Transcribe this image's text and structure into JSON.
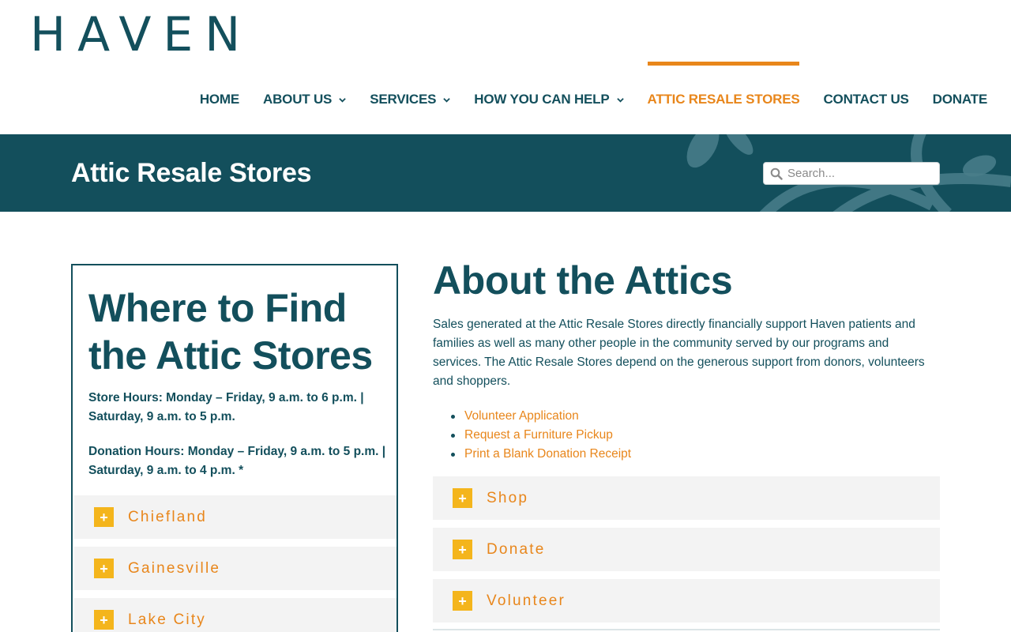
{
  "brand": {
    "logo": "HAVEN"
  },
  "nav": {
    "items": [
      {
        "label": "HOME",
        "has_dropdown": false
      },
      {
        "label": "ABOUT US",
        "has_dropdown": true
      },
      {
        "label": "SERVICES",
        "has_dropdown": true
      },
      {
        "label": "HOW YOU CAN HELP",
        "has_dropdown": true
      },
      {
        "label": "ATTIC RESALE STORES",
        "has_dropdown": false,
        "active": true
      },
      {
        "label": "CONTACT US",
        "has_dropdown": false
      },
      {
        "label": "DONATE",
        "has_dropdown": false
      }
    ]
  },
  "banner": {
    "title": "Attic Resale Stores",
    "search_placeholder": "Search..."
  },
  "sidebar": {
    "title": "Where to Find the Attic Stores",
    "store_hours": "Store Hours: Monday – Friday, 9 a.m. to 6 p.m. | Saturday, 9 a.m. to 5 p.m.",
    "donation_hours": "Donation Hours: Monday – Friday, 9 a.m. to 5 p.m. | Saturday, 9 a.m. to 4 p.m. *",
    "locations": [
      {
        "label": "Chiefland",
        "icon": "+"
      },
      {
        "label": "Gainesville",
        "icon": "+"
      },
      {
        "label": "Lake City",
        "icon": "+"
      }
    ]
  },
  "main": {
    "title": "About the Attics",
    "paragraph": "Sales generated at the Attic Resale Stores directly financially support Haven patients and families as well as many other people in the community served by our programs and services. The Attic Resale Stores depend on the generous support from donors, volunteers and shoppers.",
    "links": [
      "Volunteer Application",
      "Request a Furniture Pickup",
      "Print a Blank Donation Receipt"
    ],
    "accordions": [
      {
        "label": "Shop",
        "icon": "+"
      },
      {
        "label": "Donate",
        "icon": "+"
      },
      {
        "label": "Volunteer",
        "icon": "+"
      }
    ]
  },
  "colors": {
    "primary": "#134f5c",
    "accent": "#e8861b",
    "plus_bg": "#f4b51c",
    "panel_bg": "#f3f3f3"
  }
}
